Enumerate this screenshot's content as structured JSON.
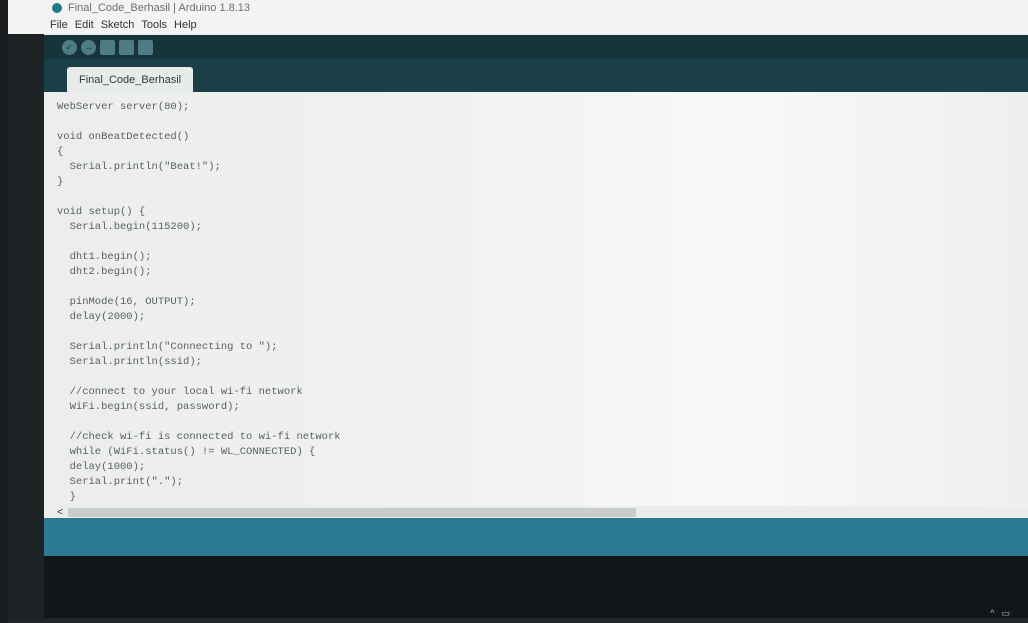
{
  "window": {
    "title": "Final_Code_Berhasil | Arduino 1.8.13"
  },
  "menu": [
    "File",
    "Edit",
    "Sketch",
    "Tools",
    "Help"
  ],
  "toolbar": {
    "buttons": [
      "verify-icon",
      "upload-icon",
      "new-icon",
      "open-icon",
      "save-icon"
    ]
  },
  "tabs": [
    {
      "label": "Final_Code_Berhasil"
    }
  ],
  "code": [
    "WebServer server(80);",
    "",
    "void onBeatDetected()",
    "{",
    "  Serial.println(\"Beat!\");",
    "}",
    "",
    "void setup() {",
    "  Serial.begin(115200);",
    "",
    "  dht1.begin();",
    "  dht2.begin();",
    "",
    "  pinMode(16, OUTPUT);",
    "  delay(2000);",
    "",
    "  Serial.println(\"Connecting to \");",
    "  Serial.println(ssid);",
    "",
    "  //connect to your local wi-fi network",
    "  WiFi.begin(ssid, password);",
    "",
    "  //check wi-fi is connected to wi-fi network",
    "  while (WiFi.status() != WL_CONNECTED) {",
    "  delay(1000);",
    "  Serial.print(\".\");",
    "  }"
  ],
  "scrollbar": {
    "left_arrow": "<"
  },
  "colors": {
    "teal": "#2b7a91",
    "toolbar": "#17343a"
  }
}
